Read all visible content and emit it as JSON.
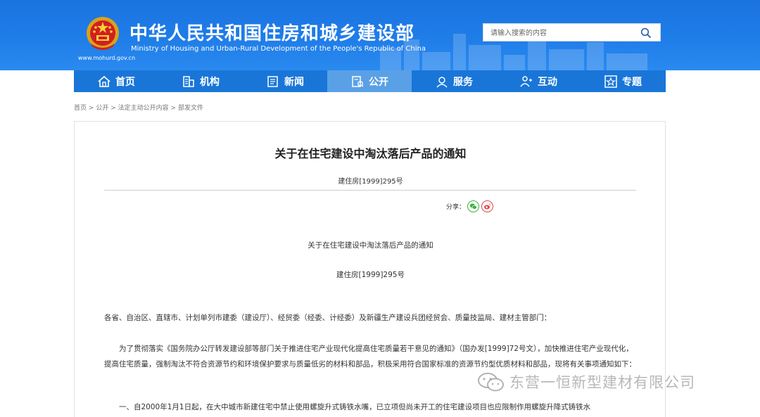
{
  "header": {
    "site_name": "中华人民共和国住房和城乡建设部",
    "site_name_en": "Ministry of Housing and Urban-Rural Development of the People's Republic of China",
    "site_url": "www.mohurd.gov.cn",
    "search_placeholder": "请输入搜索的内容",
    "search_icon": "search-icon"
  },
  "nav": {
    "items": [
      {
        "label": "首页",
        "icon": "home-icon"
      },
      {
        "label": "机构",
        "icon": "building-icon"
      },
      {
        "label": "新闻",
        "icon": "news-icon"
      },
      {
        "label": "公开",
        "icon": "document-icon"
      },
      {
        "label": "服务",
        "icon": "service-icon"
      },
      {
        "label": "互动",
        "icon": "user-interaction-icon"
      },
      {
        "label": "专题",
        "icon": "star-icon"
      }
    ],
    "active_index": 3
  },
  "breadcrumb": {
    "items": [
      "首页",
      "公开",
      "法定主动公开内容",
      "部发文件"
    ],
    "separator": ">"
  },
  "article": {
    "title": "关于在住宅建设中淘汰落后产品的通知",
    "doc_number": "建住房[1999]295号",
    "share_label": "分享：",
    "body_title": "关于在住宅建设中淘汰落后产品的通知",
    "body_doc_number": "建住房[1999]295号",
    "para1": "各省、自治区、直辖市、计划单列市建委（建设厅）、经贸委（经委、计经委）及新疆生产建设兵团经贸会、质量技监局、建材主管部门：",
    "para2": "为了贯彻落实《国务院办公厅转发建设部等部门关于推进住宅产业现代化提高住宅质量若干意见的通知》（国办发[1999]72号文），加快推进住宅产业现代化，提高住宅质量，强制淘汰不符合资源节约和环境保护要求与质量低劣的材料和部品，积极采用符合国家标准的资源节约型优质材料和部品，现将有关事项通知如下：",
    "para3": "一、自2000年1月1日起，在大中城市新建住宅中禁止使用螺旋升式铸铁水嘴，已立项但尚未开工的住宅建设项目也应限制作用螺旋升降式铸铁水"
  },
  "watermark": {
    "text": "东营一恒新型建材有限公司"
  },
  "colors": {
    "header_blue": "#1f7de8",
    "nav_blue": "#1976d8",
    "nav_active": "#5aa0e6"
  }
}
